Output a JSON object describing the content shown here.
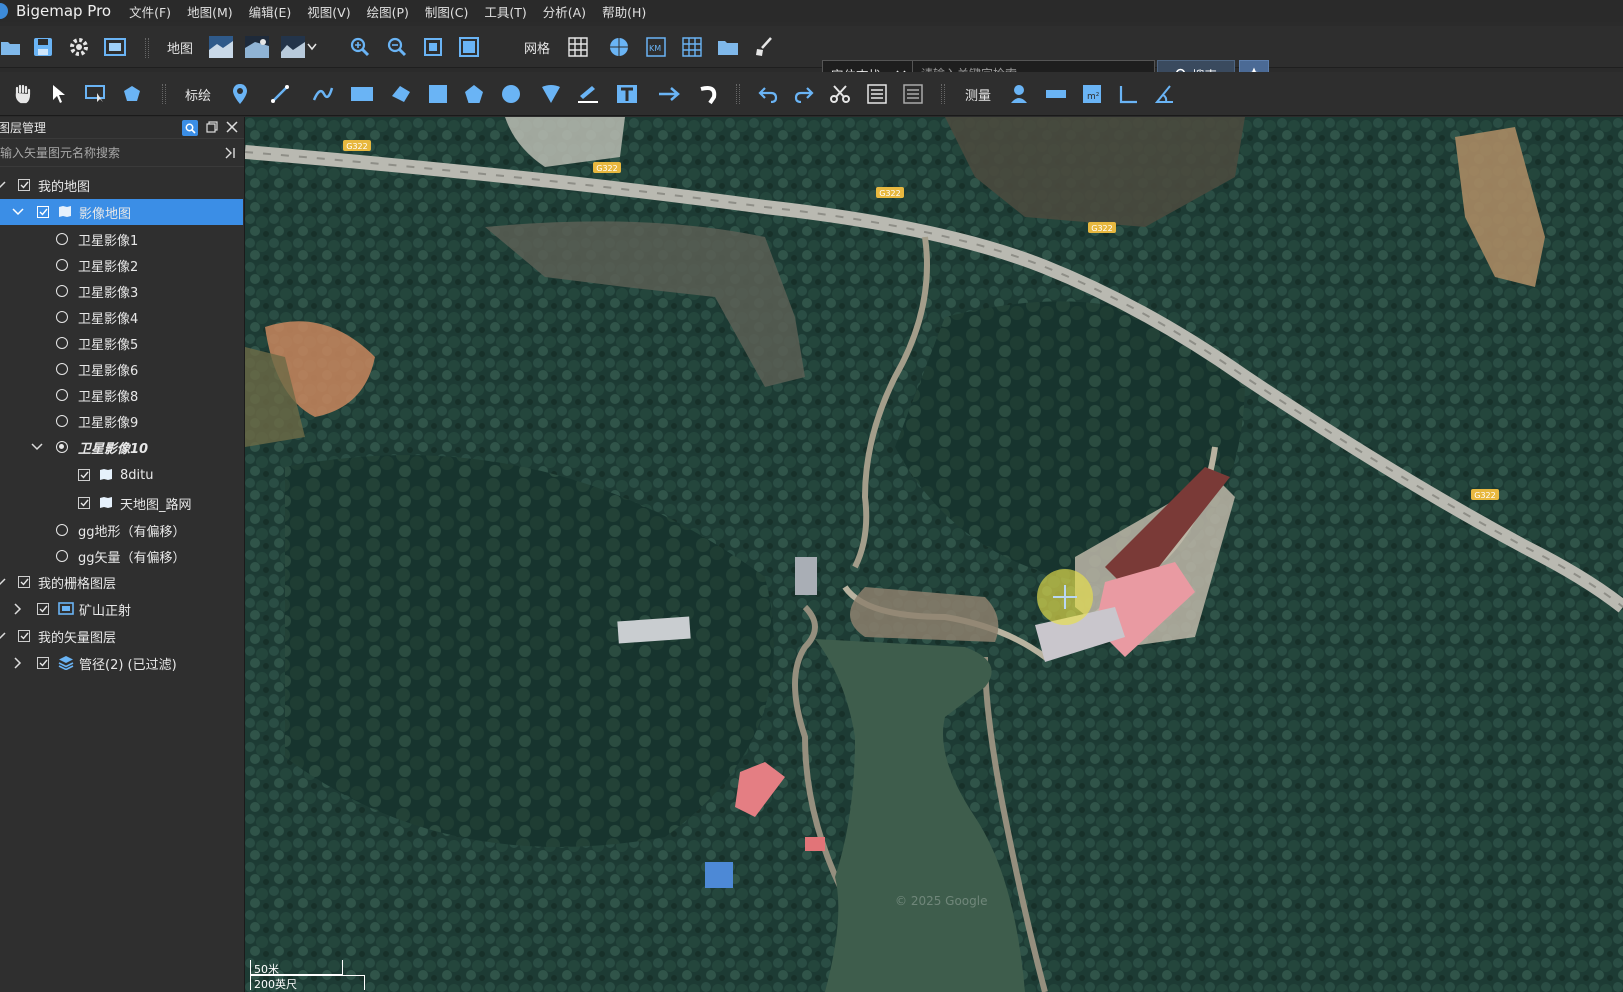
{
  "app": {
    "title": "Bigemap Pro"
  },
  "menu": [
    "文件(F)",
    "地图(M)",
    "编辑(E)",
    "视图(V)",
    "绘图(P)",
    "制图(C)",
    "工具(T)",
    "分析(A)",
    "帮助(H)"
  ],
  "toolbar1": {
    "map_label": "地图",
    "grid_label": "网格",
    "search_mode": "定位查找",
    "search_placeholder": "请输入关键字检索",
    "search_button": "搜索"
  },
  "toolbar2": {
    "annotate_label": "标绘",
    "measure_label": "测量"
  },
  "layer_panel": {
    "title": "图层管理",
    "search_placeholder": "输入矢量图元名称搜索",
    "items": [
      {
        "label": "我的地图",
        "control": "checkbox",
        "checked": true
      },
      {
        "label": "影像地图",
        "control": "checkbox",
        "checked": true,
        "selected": true
      },
      {
        "label": "卫星影像1",
        "control": "radio",
        "checked": false
      },
      {
        "label": "卫星影像2",
        "control": "radio",
        "checked": false
      },
      {
        "label": "卫星影像3",
        "control": "radio",
        "checked": false
      },
      {
        "label": "卫星影像4",
        "control": "radio",
        "checked": false
      },
      {
        "label": "卫星影像5",
        "control": "radio",
        "checked": false
      },
      {
        "label": "卫星影像6",
        "control": "radio",
        "checked": false
      },
      {
        "label": "卫星影像8",
        "control": "radio",
        "checked": false
      },
      {
        "label": "卫星影像9",
        "control": "radio",
        "checked": false
      },
      {
        "label": "卫星影像10",
        "control": "radio",
        "checked": true
      },
      {
        "label": "8ditu",
        "control": "checkbox",
        "checked": true
      },
      {
        "label": "天地图_路网",
        "control": "checkbox",
        "checked": true
      },
      {
        "label": "gg地形（有偏移）",
        "control": "radio",
        "checked": false
      },
      {
        "label": "gg矢量（有偏移）",
        "control": "radio",
        "checked": false
      },
      {
        "label": "我的栅格图层",
        "control": "checkbox",
        "checked": true
      },
      {
        "label": "矿山正射",
        "control": "checkbox",
        "checked": true
      },
      {
        "label": "我的矢量图层",
        "control": "checkbox",
        "checked": true
      },
      {
        "label": "管径(2) (已过滤)",
        "control": "checkbox",
        "checked": true
      }
    ]
  },
  "map": {
    "road_labels": [
      "G322",
      "G322",
      "G322",
      "G322",
      "G322"
    ],
    "watermark": "© 2025 Google",
    "scale_metric": "50米",
    "scale_imperial": "200英尺"
  },
  "colors": {
    "accent": "#3b8ee6",
    "panel_bg": "#2f2f2f",
    "toolbar_bg": "#2e2e2e",
    "icon_blue": "#6ab4f5"
  }
}
